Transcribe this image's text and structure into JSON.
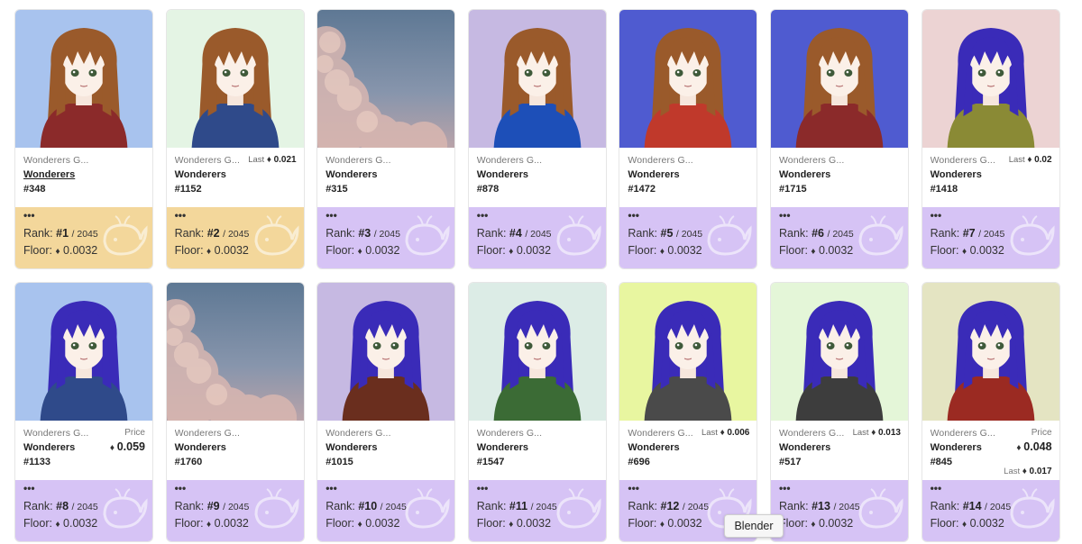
{
  "tooltip": "Blender",
  "colors": {
    "footer_orange": "#f3d79b",
    "footer_purple": "#d6c3f5"
  },
  "labels": {
    "rank": "Rank:",
    "floor": "Floor:",
    "last": "Last",
    "price": "Price",
    "dots": "•••"
  },
  "cards": [
    {
      "collection": "Wonderers G...",
      "name": "Wonderers",
      "number": "#348",
      "underline": true,
      "bg": "#a8c3ee",
      "hair": "#9a5a2b",
      "outfit": "#8b2a2a",
      "rank": "#1",
      "total": "/ 2045",
      "floor": "0.0032",
      "footer": "orange",
      "last": "",
      "price": "",
      "last_sub": ""
    },
    {
      "collection": "Wonderers G...",
      "name": "Wonderers",
      "number": "#1152",
      "underline": false,
      "bg": "#e4f4e4",
      "hair": "#9a5a2b",
      "outfit": "#2f4a8a",
      "rank": "#2",
      "total": "/ 2045",
      "floor": "0.0032",
      "footer": "orange",
      "last": "0.021",
      "price": "",
      "last_sub": ""
    },
    {
      "collection": "Wonderers G...",
      "name": "Wonderers",
      "number": "#315",
      "underline": false,
      "bg": "sky",
      "hair": "",
      "outfit": "",
      "rank": "#3",
      "total": "/ 2045",
      "floor": "0.0032",
      "footer": "purple",
      "last": "",
      "price": "",
      "last_sub": ""
    },
    {
      "collection": "Wonderers G...",
      "name": "Wonderers",
      "number": "#878",
      "underline": false,
      "bg": "#c6b9e2",
      "hair": "#9a5a2b",
      "outfit": "#1d4fb8",
      "rank": "#4",
      "total": "/ 2045",
      "floor": "0.0032",
      "footer": "purple",
      "last": "",
      "price": "",
      "last_sub": ""
    },
    {
      "collection": "Wonderers G...",
      "name": "Wonderers",
      "number": "#1472",
      "underline": false,
      "bg": "#4f5bd0",
      "hair": "#9a5a2b",
      "outfit": "#c0392b",
      "rank": "#5",
      "total": "/ 2045",
      "floor": "0.0032",
      "footer": "purple",
      "last": "",
      "price": "",
      "last_sub": ""
    },
    {
      "collection": "Wonderers G...",
      "name": "Wonderers",
      "number": "#1715",
      "underline": false,
      "bg": "#4f5bd0",
      "hair": "#9a5a2b",
      "outfit": "#8b2a2a",
      "rank": "#6",
      "total": "/ 2045",
      "floor": "0.0032",
      "footer": "purple",
      "last": "",
      "price": "",
      "last_sub": ""
    },
    {
      "collection": "Wonderers G...",
      "name": "Wonderers",
      "number": "#1418",
      "underline": false,
      "bg": "#ecd3d3",
      "hair": "#3a2bb8",
      "outfit": "#8a8a35",
      "rank": "#7",
      "total": "/ 2045",
      "floor": "0.0032",
      "footer": "purple",
      "last": "0.02",
      "price": "",
      "last_sub": ""
    },
    {
      "collection": "Wonderers G...",
      "name": "Wonderers",
      "number": "#1133",
      "underline": false,
      "bg": "#a8c3ee",
      "hair": "#3a2bb8",
      "outfit": "#2f4a8a",
      "rank": "#8",
      "total": "/ 2045",
      "floor": "0.0032",
      "footer": "purple",
      "last": "",
      "price": "0.059",
      "last_sub": ""
    },
    {
      "collection": "Wonderers G...",
      "name": "Wonderers",
      "number": "#1760",
      "underline": false,
      "bg": "sky",
      "hair": "",
      "outfit": "",
      "rank": "#9",
      "total": "/ 2045",
      "floor": "0.0032",
      "footer": "purple",
      "last": "",
      "price": "",
      "last_sub": ""
    },
    {
      "collection": "Wonderers G...",
      "name": "Wonderers",
      "number": "#1015",
      "underline": false,
      "bg": "#c6b9e2",
      "hair": "#3a2bb8",
      "outfit": "#6a2e1e",
      "rank": "#10",
      "total": "/ 2045",
      "floor": "0.0032",
      "footer": "purple",
      "last": "",
      "price": "",
      "last_sub": ""
    },
    {
      "collection": "Wonderers G...",
      "name": "Wonderers",
      "number": "#1547",
      "underline": false,
      "bg": "#dcece6",
      "hair": "#3a2bb8",
      "outfit": "#3b6b35",
      "rank": "#11",
      "total": "/ 2045",
      "floor": "0.0032",
      "footer": "purple",
      "last": "",
      "price": "",
      "last_sub": ""
    },
    {
      "collection": "Wonderers G...",
      "name": "Wonderers",
      "number": "#696",
      "underline": false,
      "bg": "#e8f6a0",
      "hair": "#3a2bb8",
      "outfit": "#4a4a4a",
      "rank": "#12",
      "total": "/ 2045",
      "floor": "0.0032",
      "footer": "purple",
      "last": "0.006",
      "price": "",
      "last_sub": ""
    },
    {
      "collection": "Wonderers G...",
      "name": "Wonderers",
      "number": "#517",
      "underline": false,
      "bg": "#e4f6d8",
      "hair": "#3a2bb8",
      "outfit": "#3d3d3d",
      "rank": "#13",
      "total": "/ 2045",
      "floor": "0.0032",
      "footer": "purple",
      "last": "0.013",
      "price": "",
      "last_sub": ""
    },
    {
      "collection": "Wonderers G...",
      "name": "Wonderers",
      "number": "#845",
      "underline": false,
      "bg": "#e4e4c2",
      "hair": "#3a2bb8",
      "outfit": "#9b2a22",
      "rank": "#14",
      "total": "/ 2045",
      "floor": "0.0032",
      "footer": "purple",
      "last": "",
      "price": "0.048",
      "last_sub": "0.017"
    }
  ]
}
